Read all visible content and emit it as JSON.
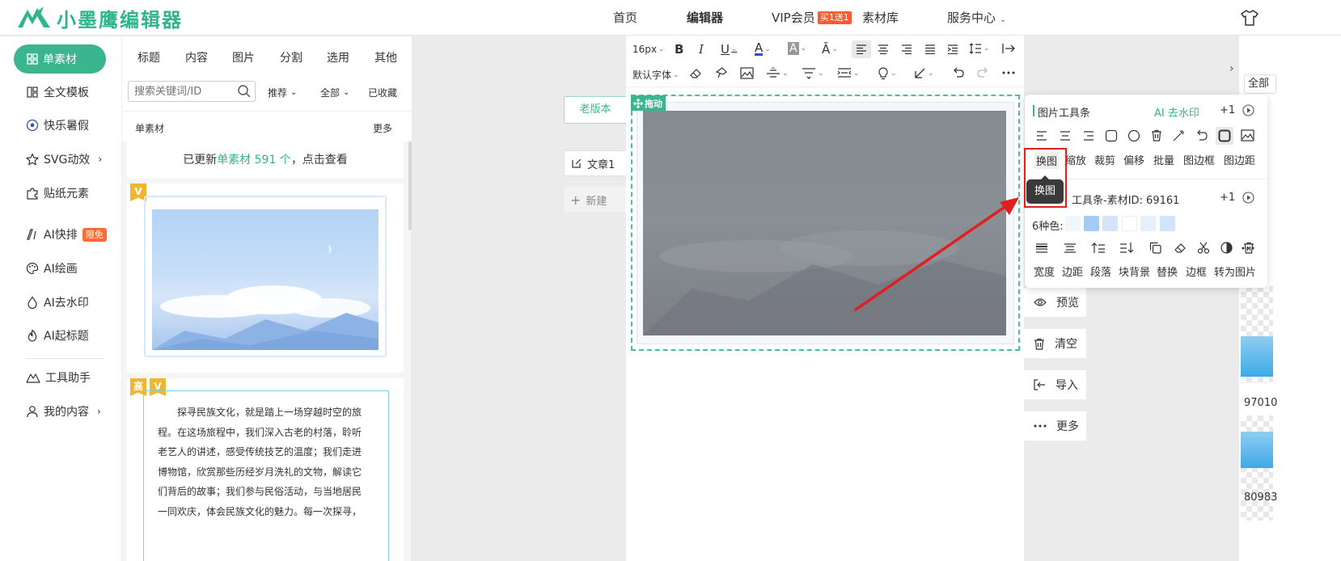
{
  "header": {
    "logo_text": "小墨鹰编辑器",
    "nav": [
      "首页",
      "编辑器",
      "VIP会员",
      "素材库",
      "服务中心"
    ],
    "vip_badge": "买1送1"
  },
  "left_menu": {
    "active": "单素材",
    "items": [
      "全文模板",
      "快乐暑假",
      "SVG动效",
      "贴纸元素",
      "AI快排",
      "AI绘画",
      "AI去水印",
      "AI起标题",
      "工具助手",
      "我的内容"
    ],
    "limited_badge": "限免"
  },
  "materials": {
    "categories": [
      "标题",
      "内容",
      "图片",
      "分割",
      "选用",
      "其他"
    ],
    "search_placeholder": "搜索关键词/ID",
    "filter_recommend": "推荐",
    "filter_all": "全部",
    "favorites": "已收藏",
    "section_title": "单素材",
    "section_more": "更多",
    "update_prefix": "已更新",
    "update_highlight": "单素材 591 个",
    "update_suffix": "，点击查看",
    "badge_v": "V",
    "badge_high": "高",
    "article_lines": [
      "探寻民族文化，就是踏上一场穿越时空的旅",
      "程。在这场旅程中，我们深入古老的村落，聆听",
      "老艺人的讲述，感受传统技艺的温度；我们走进",
      "博物馆，欣赏那些历经岁月洗礼的文物，解读它",
      "们背后的故事；我们参与民俗活动，与当地居民",
      "一同欢庆，体会民族文化的魅力。每一次探寻，"
    ]
  },
  "editor": {
    "old_version": "老版本",
    "doc_tab": "文章1",
    "new_doc": "新建",
    "font_size": "16px",
    "font_family": "默认字体",
    "drag_label": "拖动"
  },
  "side_actions": [
    "预览",
    "清空",
    "导入",
    "更多"
  ],
  "image_toolbar": {
    "title": "图片工具条",
    "ai_remove": "AI 去水印",
    "plus": "+1",
    "actions": [
      "换图",
      "缩放",
      "裁剪",
      "偏移",
      "批量",
      "图边框",
      "图边距"
    ],
    "tooltip": "换图"
  },
  "material_toolbar": {
    "title": "工具条-素材ID: 69161",
    "plus": "+1",
    "colors_label": "6种色:",
    "colors": [
      "#f0f6fe",
      "#a8cbf5",
      "#d4e5fb",
      "#ffffff",
      "#e6f0fd",
      "#d2e4fb"
    ],
    "actions": [
      "宽度",
      "边距",
      "段落",
      "块背景",
      "替换",
      "边框",
      "转为图片"
    ]
  },
  "right_strip": {
    "chip": "全部",
    "ids": [
      "97010",
      "80983"
    ]
  },
  "colors": {
    "brand": "#3bb58e",
    "annotation": "#e02020"
  }
}
